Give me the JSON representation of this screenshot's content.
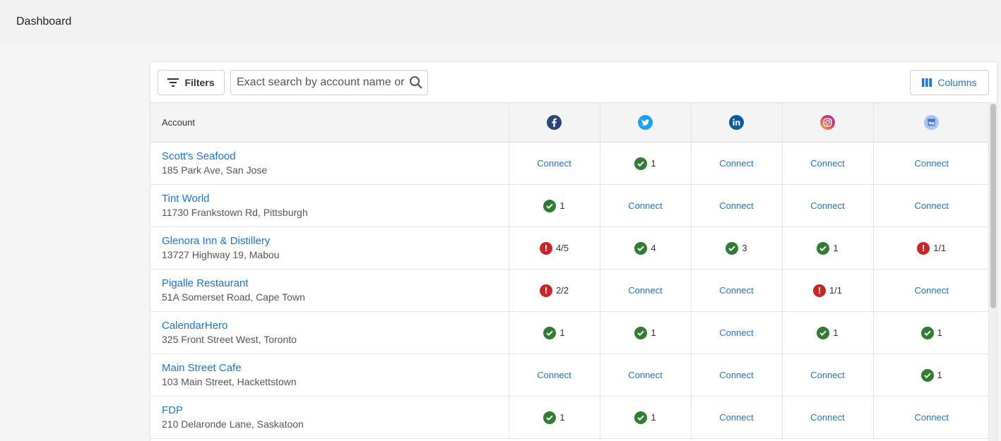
{
  "header": {
    "title": "Dashboard"
  },
  "toolbar": {
    "filters_label": "Filters",
    "search_placeholder": "Exact search by account name or",
    "columns_label": "Columns"
  },
  "table": {
    "account_header": "Account",
    "networks": [
      {
        "name": "facebook-icon",
        "color": "#3b5998"
      },
      {
        "name": "twitter-icon",
        "color": "#1da1f2"
      },
      {
        "name": "linkedin-icon",
        "color": "#0a66c2"
      },
      {
        "name": "instagram-icon",
        "color": "#e4405f"
      },
      {
        "name": "google-my-business-icon",
        "color": "#8ab4f8"
      }
    ],
    "connect_label": "Connect",
    "rows": [
      {
        "name": "Scott's Seafood",
        "address": "185 Park Ave, San Jose",
        "cells": [
          {
            "state": "connect"
          },
          {
            "state": "ok",
            "text": "1"
          },
          {
            "state": "connect"
          },
          {
            "state": "connect"
          },
          {
            "state": "connect"
          }
        ]
      },
      {
        "name": "Tint World",
        "address": "11730 Frankstown Rd, Pittsburgh",
        "cells": [
          {
            "state": "ok",
            "text": "1"
          },
          {
            "state": "connect"
          },
          {
            "state": "connect"
          },
          {
            "state": "connect"
          },
          {
            "state": "connect"
          }
        ]
      },
      {
        "name": "Glenora Inn & Distillery",
        "address": "13727 Highway 19, Mabou",
        "cells": [
          {
            "state": "err",
            "text": "4/5"
          },
          {
            "state": "ok",
            "text": "4"
          },
          {
            "state": "ok",
            "text": "3"
          },
          {
            "state": "ok",
            "text": "1"
          },
          {
            "state": "err",
            "text": "1/1"
          }
        ]
      },
      {
        "name": "Pigalle Restaurant",
        "address": "51A Somerset Road, Cape Town",
        "cells": [
          {
            "state": "err",
            "text": "2/2"
          },
          {
            "state": "connect"
          },
          {
            "state": "connect"
          },
          {
            "state": "err",
            "text": "1/1"
          },
          {
            "state": "connect"
          }
        ]
      },
      {
        "name": "CalendarHero",
        "address": "325 Front Street West, Toronto",
        "cells": [
          {
            "state": "ok",
            "text": "1"
          },
          {
            "state": "ok",
            "text": "1"
          },
          {
            "state": "connect"
          },
          {
            "state": "ok",
            "text": "1"
          },
          {
            "state": "ok",
            "text": "1"
          }
        ]
      },
      {
        "name": "Main Street Cafe",
        "address": "103 Main Street, Hackettstown",
        "cells": [
          {
            "state": "connect"
          },
          {
            "state": "connect"
          },
          {
            "state": "connect"
          },
          {
            "state": "connect"
          },
          {
            "state": "ok",
            "text": "1"
          }
        ]
      },
      {
        "name": "FDP",
        "address": "210 Delaronde Lane, Saskatoon",
        "cells": [
          {
            "state": "ok",
            "text": "1"
          },
          {
            "state": "ok",
            "text": "1"
          },
          {
            "state": "connect"
          },
          {
            "state": "connect"
          },
          {
            "state": "connect"
          }
        ]
      }
    ]
  }
}
